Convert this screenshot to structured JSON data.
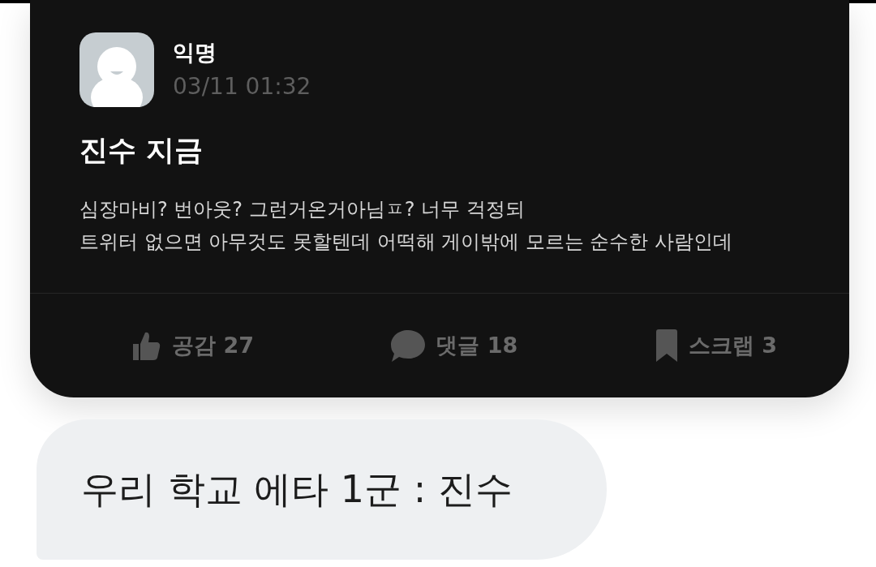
{
  "post": {
    "author": "익명",
    "timestamp": "03/11 01:32",
    "title": "진수 지금",
    "body": "심장마비? 번아웃? 그런거온거아님ㅍ? 너무 걱정되\n트위터 없으면 아무것도 못할텐데 어떡해 게이밖에 모르는 순수한 사람인데",
    "actions": [
      {
        "kind": "like",
        "label": "공감 27"
      },
      {
        "kind": "comment",
        "label": "댓글 18"
      },
      {
        "kind": "scrap",
        "label": "스크랩 3"
      }
    ]
  },
  "caption": "우리 학교 에타 1군 : 진수"
}
